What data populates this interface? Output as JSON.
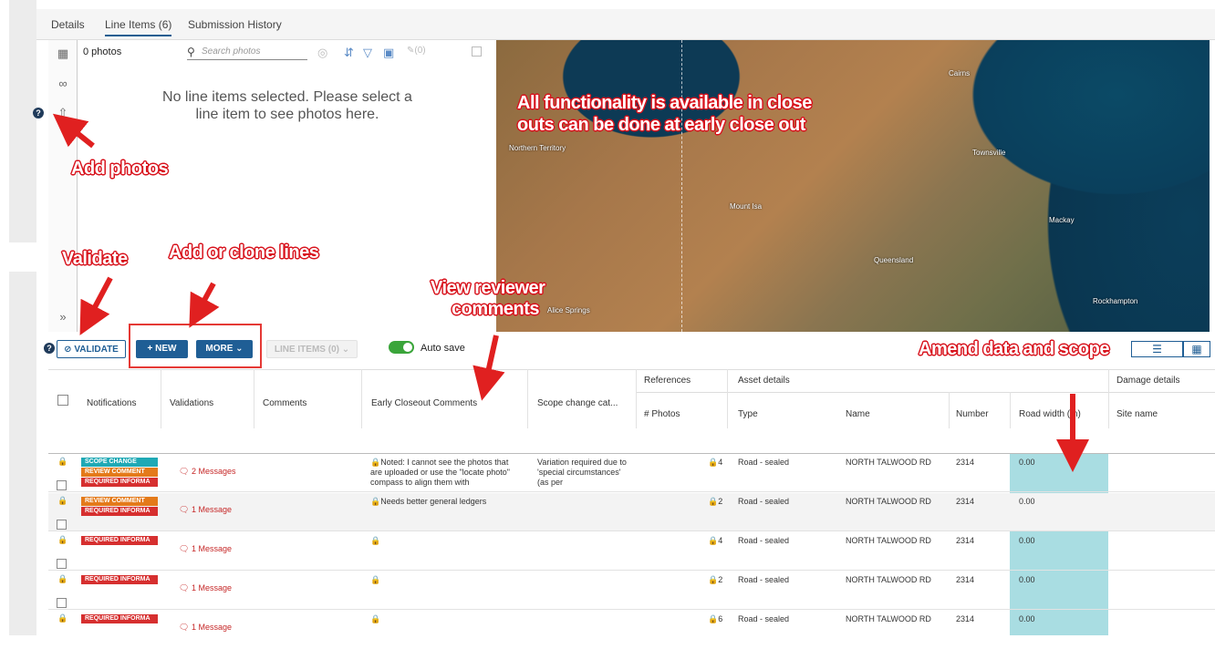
{
  "tabs": [
    "Details",
    "Line Items (6)",
    "Submission History"
  ],
  "photos": {
    "count_label": "0 photos",
    "search_placeholder": "Search photos",
    "edit_count": "(0)",
    "empty_message": "No line items selected. Please select a line item to see photos here."
  },
  "map": {
    "labels": [
      "Cairns",
      "Northern Territory",
      "Townsville",
      "Mount Isa",
      "Mackay",
      "Queensland",
      "Rockhampton",
      "Alice Springs"
    ]
  },
  "toolbar": {
    "validate": "VALIDATE",
    "new": "+ NEW",
    "more": "MORE",
    "line_items": "LINE ITEMS (0)",
    "autosave": "Auto save"
  },
  "table": {
    "group_headers": {
      "references": "References",
      "asset_details": "Asset details",
      "damage_details": "Damage details"
    },
    "columns": [
      "Notifications",
      "Validations",
      "Comments",
      "Early Closeout Comments",
      "Scope change cat...",
      "# Photos",
      "Type",
      "Name",
      "Number",
      "Road width (m)",
      "Site name"
    ],
    "rows": [
      {
        "tags": [
          "SCOPE CHANGE",
          "REVIEW COMMENT",
          "REQUIRED INFORMA"
        ],
        "validation": "2 Messages",
        "early": "Noted:  I cannot see the photos that are uploaded or use the \"locate photo\" compass to align them with",
        "scope": "Variation required due to 'special circumstances' (as per",
        "photos": "4",
        "type": "Road - sealed",
        "name": "NORTH TALWOOD RD",
        "number": "2314",
        "road_width": "0.00"
      },
      {
        "tags": [
          "REVIEW COMMENT",
          "REQUIRED INFORMA"
        ],
        "validation": "1 Message",
        "early": "Needs better general ledgers",
        "scope": "",
        "photos": "2",
        "type": "Road - sealed",
        "name": "NORTH TALWOOD RD",
        "number": "2314",
        "road_width": "0.00"
      },
      {
        "tags": [
          "REQUIRED INFORMA"
        ],
        "validation": "1 Message",
        "early": "",
        "scope": "",
        "photos": "4",
        "type": "Road - sealed",
        "name": "NORTH TALWOOD RD",
        "number": "2314",
        "road_width": "0.00"
      },
      {
        "tags": [
          "REQUIRED INFORMA"
        ],
        "validation": "1 Message",
        "early": "",
        "scope": "",
        "photos": "2",
        "type": "Road - sealed",
        "name": "NORTH TALWOOD RD",
        "number": "2314",
        "road_width": "0.00"
      },
      {
        "tags": [
          "REQUIRED INFORMA"
        ],
        "validation": "1 Message",
        "early": "",
        "scope": "",
        "photos": "6",
        "type": "Road - sealed",
        "name": "NORTH TALWOOD RD",
        "number": "2314",
        "road_width": "0.00"
      }
    ]
  },
  "annotations": {
    "add_photos": "Add photos",
    "validate": "Validate",
    "add_clone": "Add or clone lines",
    "view_reviewer_line1": "View reviewer",
    "view_reviewer_line2": "comments",
    "functionality_line1": "All functionality is available in close",
    "functionality_line2": "outs can be done at early close out",
    "amend": "Amend data and scope"
  },
  "colors": {
    "primary": "#1f5e95",
    "scope_change": "#1fa9b5",
    "review_comment": "#e47a1a",
    "required_info": "#d62f2f",
    "highlight": "#a9dde2",
    "annotation_red": "#d8131d"
  }
}
